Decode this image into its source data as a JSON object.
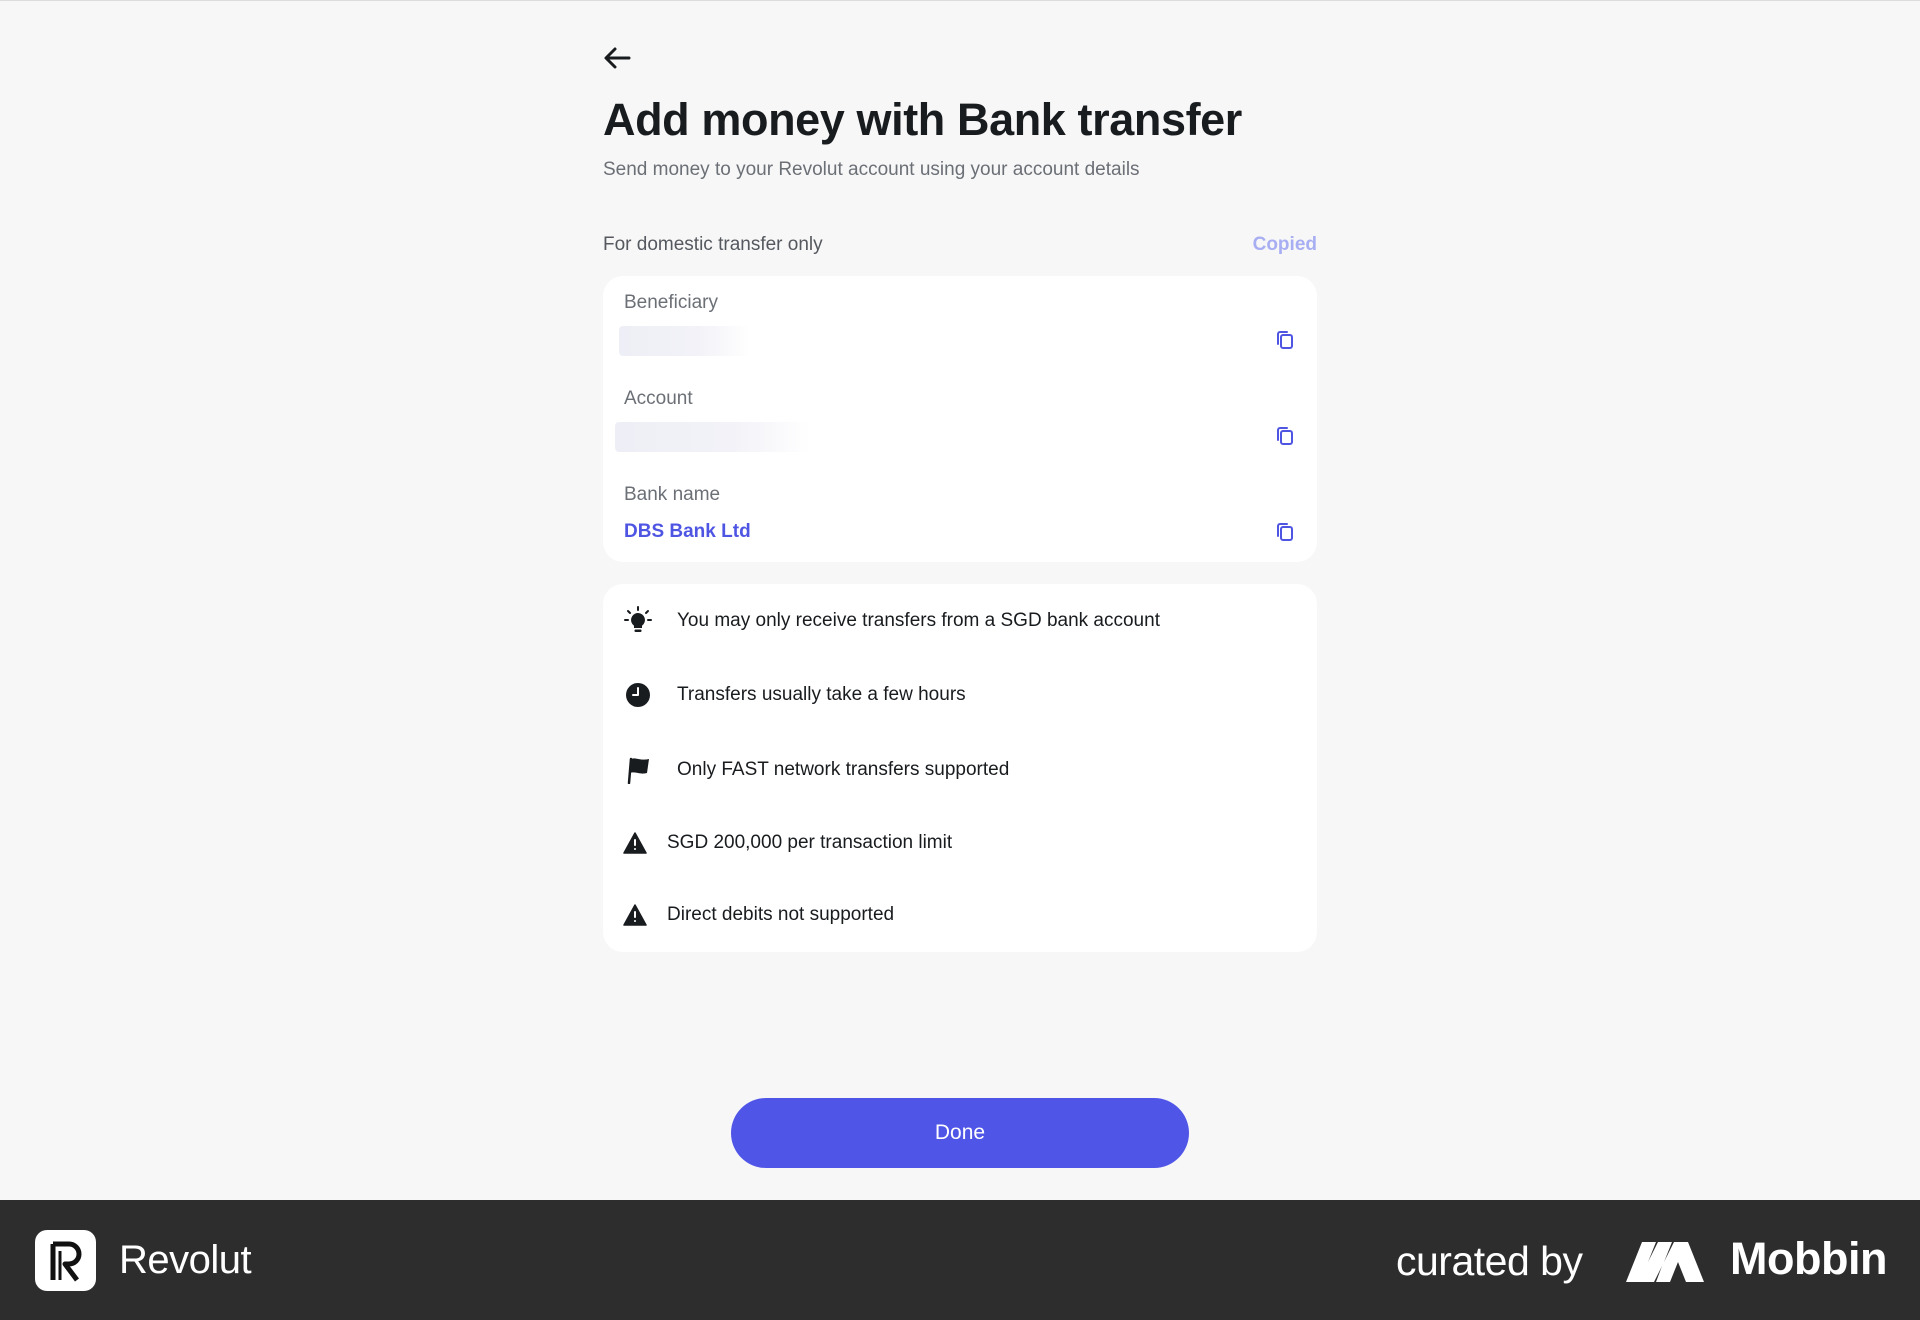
{
  "header": {
    "back_icon": "arrow-left-icon",
    "title": "Add money with Bank transfer",
    "subtitle": "Send money to your Revolut account using your account details"
  },
  "details": {
    "section_label": "For domestic transfer only",
    "copied_label": "Copied",
    "rows": [
      {
        "label": "Beneficiary",
        "value": ""
      },
      {
        "label": "Account",
        "value": ""
      },
      {
        "label": "Bank name",
        "value": "DBS Bank Ltd"
      }
    ]
  },
  "info": {
    "items": [
      {
        "icon": "lightbulb-icon",
        "text": "You may only receive transfers from a SGD bank account"
      },
      {
        "icon": "clock-icon",
        "text": "Transfers usually take a few hours"
      },
      {
        "icon": "flag-icon",
        "text": "Only FAST network transfers supported"
      },
      {
        "icon": "warning-icon",
        "text": "SGD 200,000 per transaction limit"
      },
      {
        "icon": "warning-icon",
        "text": "Direct debits not supported"
      }
    ]
  },
  "actions": {
    "done_label": "Done"
  },
  "footer": {
    "brand_name": "Revolut",
    "curated_by": "curated by",
    "mobbin_name": "Mobbin"
  },
  "colors": {
    "accent": "#4f55e7",
    "link": "#4f55e3",
    "copied": "#a8aef2",
    "background": "#f7f7f7",
    "footer": "#2d2d2d"
  }
}
